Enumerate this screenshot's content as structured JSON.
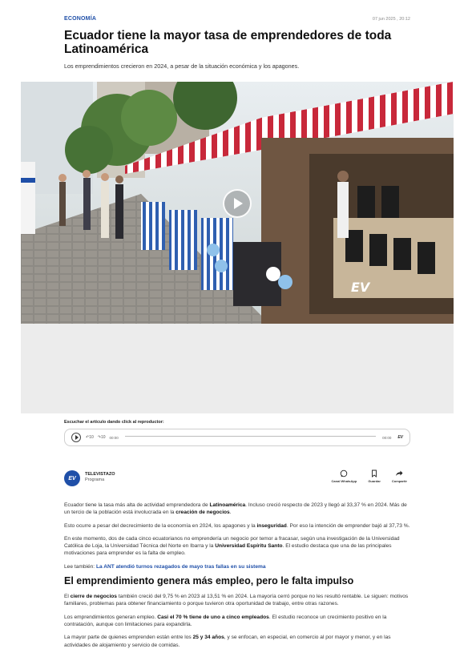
{
  "header": {
    "category": "ECONOMÍA",
    "date": "07 jun 2025 , 20:12"
  },
  "article": {
    "title": "Ecuador tiene la mayor tasa de emprendedores de toda Latinoamérica",
    "subtitle": "Los emprendimientos crecieron en 2024, a pesar de la situación económica y los apagones."
  },
  "media": {
    "play_icon": "play-icon",
    "watermark": "EV"
  },
  "audio": {
    "label": "Escuchar el artículo dando click al reproductor:",
    "skip_back": "10",
    "skip_forward": "10",
    "current_time": "00:00",
    "duration": "00:00",
    "brand": "EV"
  },
  "author": {
    "avatar_text": "EV",
    "name": "TELEVISTAZO",
    "role": "Programa"
  },
  "actions": [
    {
      "label": "Canal WhatsApp",
      "icon": "whatsapp-icon"
    },
    {
      "label": "Guardar",
      "icon": "bookmark-icon"
    },
    {
      "label": "Compartir",
      "icon": "share-icon"
    }
  ],
  "content": {
    "p1_a": "Ecuador tiene la tasa más alta de actividad emprendedora de ",
    "p1_b": "Latinoamérica",
    "p1_c": ". Incluso creció respecto de 2023 y llegó al 33,37 % en 2024. Más de un tercio de la población está involucrada en la ",
    "p1_d": "creación de negocios",
    "p1_e": ".",
    "p2_a": "Esto ocurre a pesar del decrecimiento de la economía en 2024, los apagones y la ",
    "p2_b": "inseguridad",
    "p2_c": ". Por eso la intención de emprender bajó al 37,73 %.",
    "p3_a": "En este momento, dos de cada cinco ecuatorianos no emprendería un negocio por temor a fracasar, según una investigación de la Universidad Católica de Loja, la Universidad Técnica del Norte en Ibarra y la ",
    "p3_b": "Universidad Espíritu Santo",
    "p3_c": ". El estudio destaca que una de las principales motivaciones para emprender es la falta de empleo.",
    "read_also_label": "Lee también: ",
    "read_also_link": "La ANT atendió turnos rezagados de mayo tras fallas en su sistema",
    "h2": "El emprendimiento genera más empleo, pero le falta impulso",
    "p4_a": "El ",
    "p4_b": "cierre de negocios",
    "p4_c": " también creció del 9,75 % en 2023 al 13,51 % en 2024. La mayoría cerró porque no les resultó rentable. Le siguen: motivos familiares, problemas para obtener financiamiento o porque tuvieron otra oportunidad de trabajo, entre otras razones.",
    "p5_a": "Los emprendimientos generan empleo. ",
    "p5_b": "Casi el 70 % tiene de uno a cinco empleados",
    "p5_c": ". El estudio reconoce un crecimiento positivo en la contratación, aunque con limitaciones para expandirla.",
    "p6_a": "La mayor parte de quienes emprenden están entre los ",
    "p6_b": "25 y 34 años",
    "p6_c": ", y se enfocan, en especial, en comercio al por mayor y menor, y en las actividades de alojamiento y servicio de comidas."
  }
}
